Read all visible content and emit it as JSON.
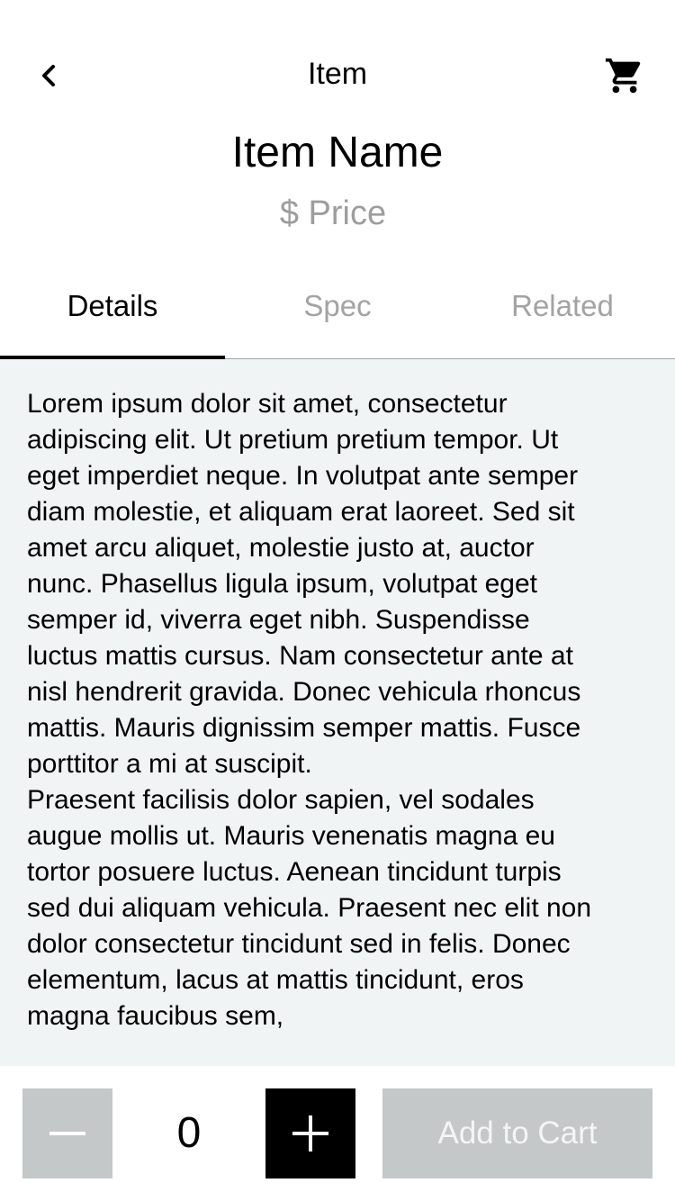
{
  "header": {
    "title": "Item",
    "back_icon": "chevron-left-icon",
    "cart_icon": "shopping-cart-icon"
  },
  "item": {
    "name": "Item Name",
    "price": "$ Price"
  },
  "tabs": [
    {
      "label": "Details",
      "active": true
    },
    {
      "label": "Spec",
      "active": false
    },
    {
      "label": "Related",
      "active": false
    }
  ],
  "details": {
    "paragraphs": [
      "Lorem ipsum dolor sit amet, consectetur adipiscing elit. Ut pretium pretium tempor. Ut eget imperdiet neque. In volutpat ante semper diam molestie, et aliquam erat laoreet. Sed sit amet arcu aliquet, molestie justo at, auctor nunc. Phasellus ligula ipsum, volutpat eget semper id, viverra eget nibh. Suspendisse luctus mattis cursus. Nam consectetur ante at nisl hendrerit gravida. Donec vehicula rhoncus mattis. Mauris dignissim semper mattis. Fusce porttitor a mi at suscipit.",
      "Praesent facilisis dolor sapien, vel sodales augue mollis ut. Mauris venenatis magna eu tortor posuere luctus. Aenean tincidunt turpis sed dui aliquam vehicula. Praesent nec elit non dolor consectetur tincidunt sed in felis. Donec elementum, lacus at mattis tincidunt, eros magna faucibus sem,"
    ]
  },
  "footer": {
    "quantity": "0",
    "minus_icon": "minus-icon",
    "plus_icon": "plus-icon",
    "add_to_cart_label": "Add to Cart"
  },
  "colors": {
    "accent": "#000000",
    "muted_text": "#9d9d9d",
    "content_bg": "#f1f4f4",
    "disabled_button": "#c5c8c8"
  }
}
